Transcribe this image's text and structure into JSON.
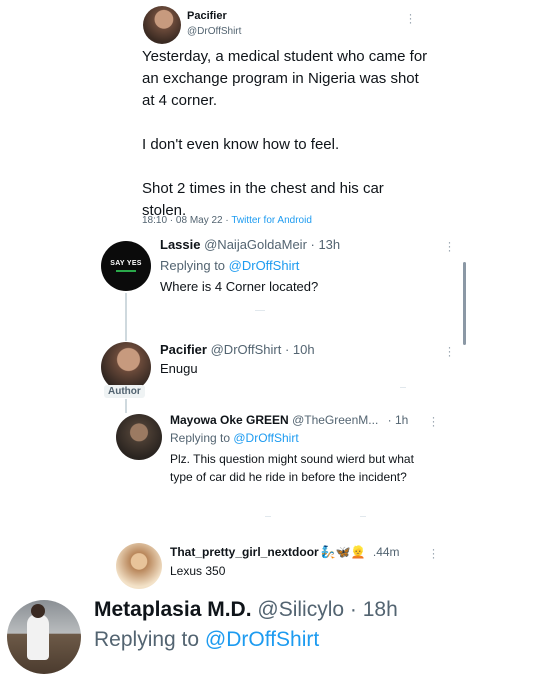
{
  "main_tweet": {
    "name": "Pacifier",
    "handle": "@DrOffShirt",
    "text": "Yesterday, a medical student who came for an exchange program in Nigeria was shot at 4 corner.\n\nI don't even know how to feel.\n\nShot 2 times in the chest and his car stolen.",
    "timestamp": "18:10 · 08 May 22 · ",
    "source": "Twitter for Android"
  },
  "replies": [
    {
      "name": "Lassie",
      "handle": "@NaijaGoldaMeir · 13h",
      "replying_prefix": "Replying to ",
      "replying_to": "@DrOffShirt",
      "text": "Where is 4 Corner located?",
      "avatar_text": "SAY YES"
    },
    {
      "name": "Pacifier",
      "handle": "@DrOffShirt · 10h",
      "text": "Enugu",
      "badge": "Author"
    },
    {
      "name": "Mayowa Oke GREEN",
      "handle": "@TheGreenM...",
      "time": "· 1h",
      "replying_prefix": "Replying to ",
      "replying_to": "@DrOffShirt",
      "text": "Plz. This question might sound wierd but what type of car did he ride in before the incident?"
    },
    {
      "name": "That_pretty_girl_nextdoor",
      "emojis": "🧞🦋👱",
      "time": ".44m",
      "text": "Lexus 350"
    }
  ],
  "bottom_tweet": {
    "name": "Metaplasia M.D.",
    "handle": "@Silicylo · 18h",
    "replying_prefix": "Replying to ",
    "replying_to": "@DrOffShirt"
  },
  "colors": {
    "link": "#1d9bf0",
    "muted": "#536471",
    "line": "#cfd9de"
  }
}
